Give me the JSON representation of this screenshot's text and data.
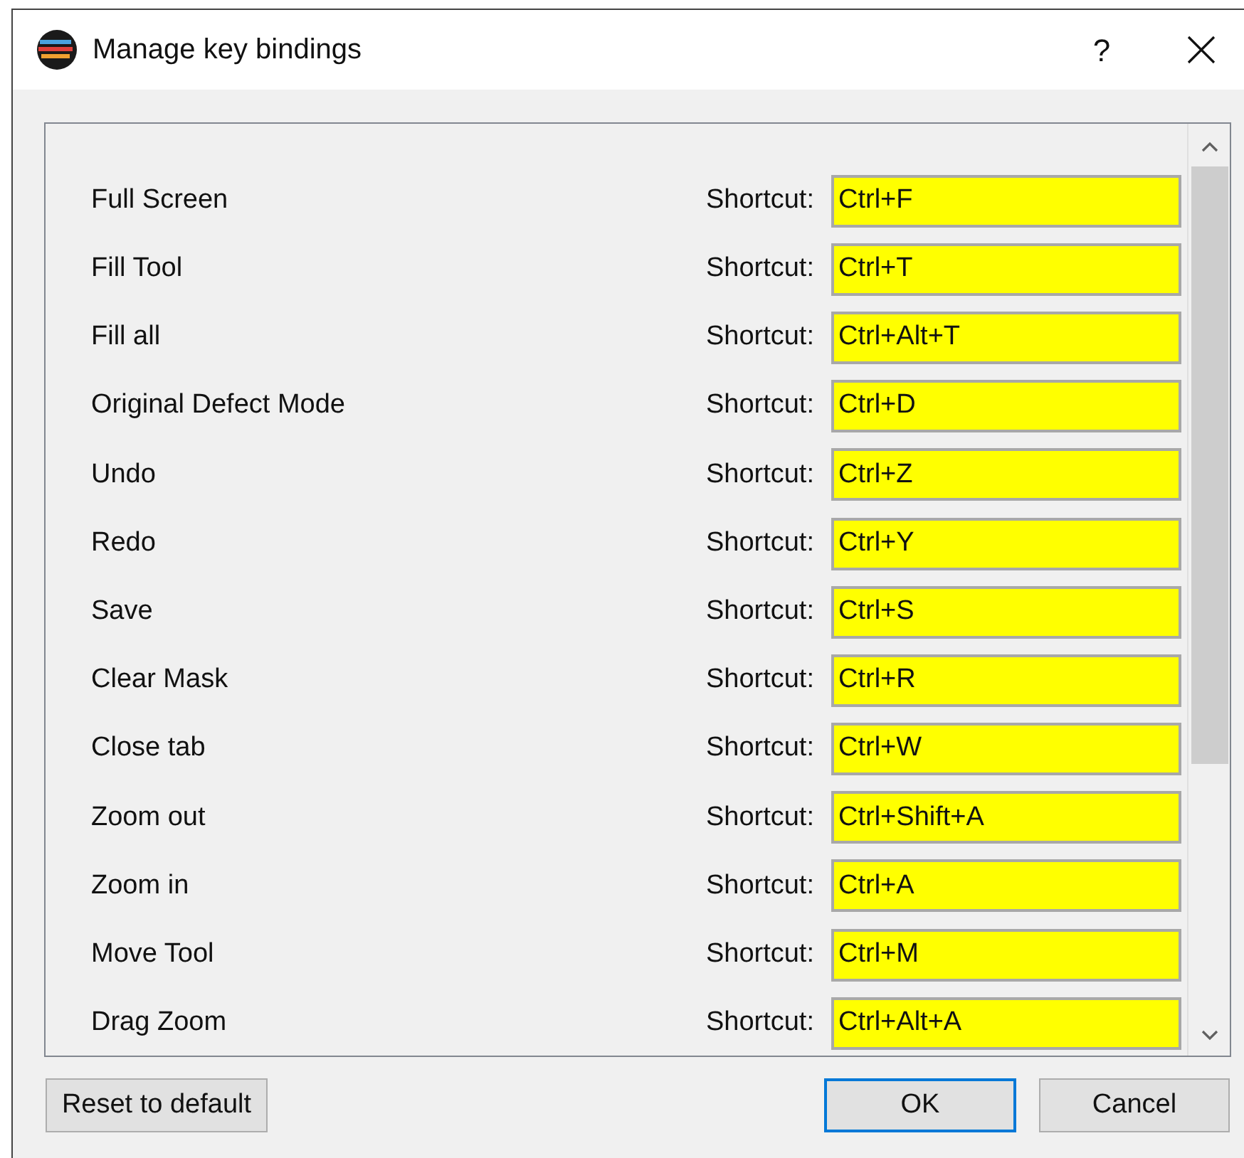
{
  "window": {
    "title": "Manage key bindings",
    "help": "?"
  },
  "bindings": [
    {
      "action": "Full Screen",
      "label": "Shortcut:",
      "value": "Ctrl+F"
    },
    {
      "action": "Fill Tool",
      "label": "Shortcut:",
      "value": "Ctrl+T"
    },
    {
      "action": "Fill all",
      "label": "Shortcut:",
      "value": "Ctrl+Alt+T"
    },
    {
      "action": "Original Defect Mode",
      "label": "Shortcut:",
      "value": "Ctrl+D"
    },
    {
      "action": "Undo",
      "label": "Shortcut:",
      "value": "Ctrl+Z"
    },
    {
      "action": "Redo",
      "label": "Shortcut:",
      "value": "Ctrl+Y"
    },
    {
      "action": "Save",
      "label": "Shortcut:",
      "value": "Ctrl+S"
    },
    {
      "action": "Clear Mask",
      "label": "Shortcut:",
      "value": "Ctrl+R"
    },
    {
      "action": "Close tab",
      "label": "Shortcut:",
      "value": "Ctrl+W"
    },
    {
      "action": "Zoom out",
      "label": "Shortcut:",
      "value": "Ctrl+Shift+A"
    },
    {
      "action": "Zoom in",
      "label": "Shortcut:",
      "value": "Ctrl+A"
    },
    {
      "action": "Move Tool",
      "label": "Shortcut:",
      "value": "Ctrl+M"
    },
    {
      "action": "Drag Zoom",
      "label": "Shortcut:",
      "value": "Ctrl+Alt+A"
    }
  ],
  "buttons": [
    {
      "label": "Reset to default",
      "focused": false
    },
    {
      "label": "OK",
      "focused": true
    },
    {
      "label": "Cancel",
      "focused": false
    }
  ]
}
